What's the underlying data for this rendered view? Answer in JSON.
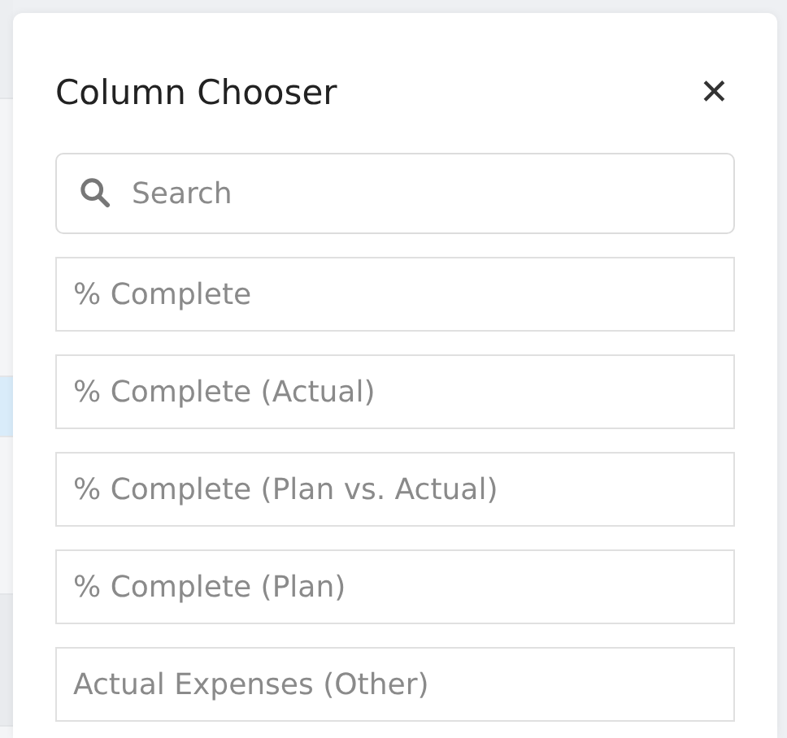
{
  "dialog": {
    "title": "Column Chooser",
    "close_label": "✕"
  },
  "search": {
    "placeholder": "Search"
  },
  "columns": [
    {
      "label": "% Complete"
    },
    {
      "label": "% Complete (Actual)"
    },
    {
      "label": "% Complete (Plan vs. Actual)"
    },
    {
      "label": "% Complete (Plan)"
    },
    {
      "label": "Actual Expenses (Other)"
    }
  ]
}
